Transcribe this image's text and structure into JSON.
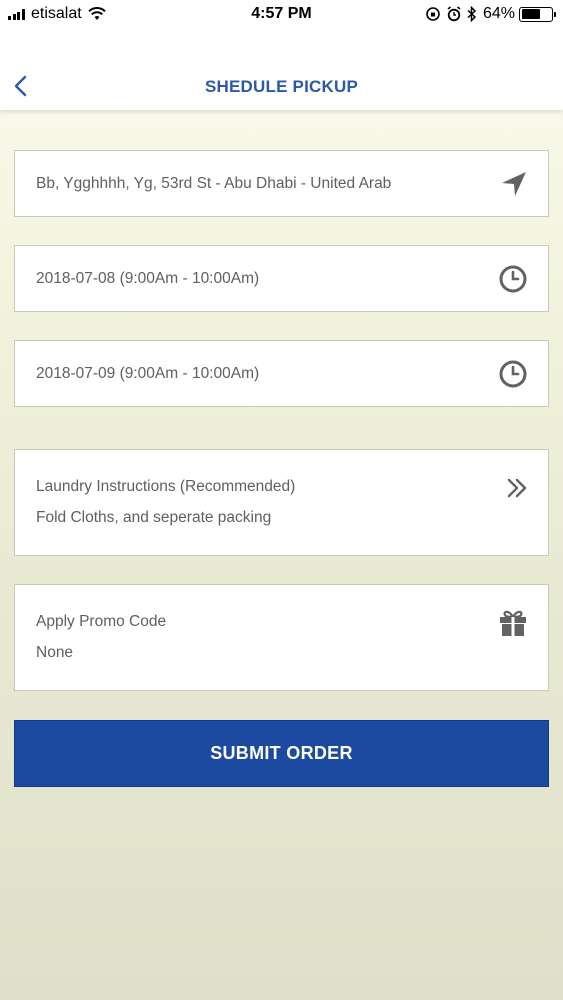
{
  "status_bar": {
    "carrier": "etisalat",
    "time": "4:57 PM",
    "battery_percent": "64%",
    "battery_level": 0.64
  },
  "header": {
    "title": "SHEDULE PICKUP",
    "back_icon": "chevron-left-icon"
  },
  "address": {
    "value": "Bb, Ygghhhh, Yg, 53rd St - Abu Dhabi - United Arab",
    "icon": "location-arrow-icon"
  },
  "pickup_slot": {
    "value": "2018-07-08 (9:00Am - 10:00Am)",
    "icon": "clock-icon"
  },
  "delivery_slot": {
    "value": "2018-07-09 (9:00Am - 10:00Am)",
    "icon": "clock-icon"
  },
  "instructions": {
    "label": "Laundry Instructions (Recommended)",
    "value": "Fold Cloths, and seperate packing",
    "icon": "double-chevron-right-icon"
  },
  "promo": {
    "label": "Apply Promo Code",
    "value": "None",
    "icon": "gift-icon"
  },
  "submit": {
    "label": "SUBMIT ORDER"
  },
  "colors": {
    "accent": "#2b59a5",
    "button": "#1d4aa1"
  }
}
